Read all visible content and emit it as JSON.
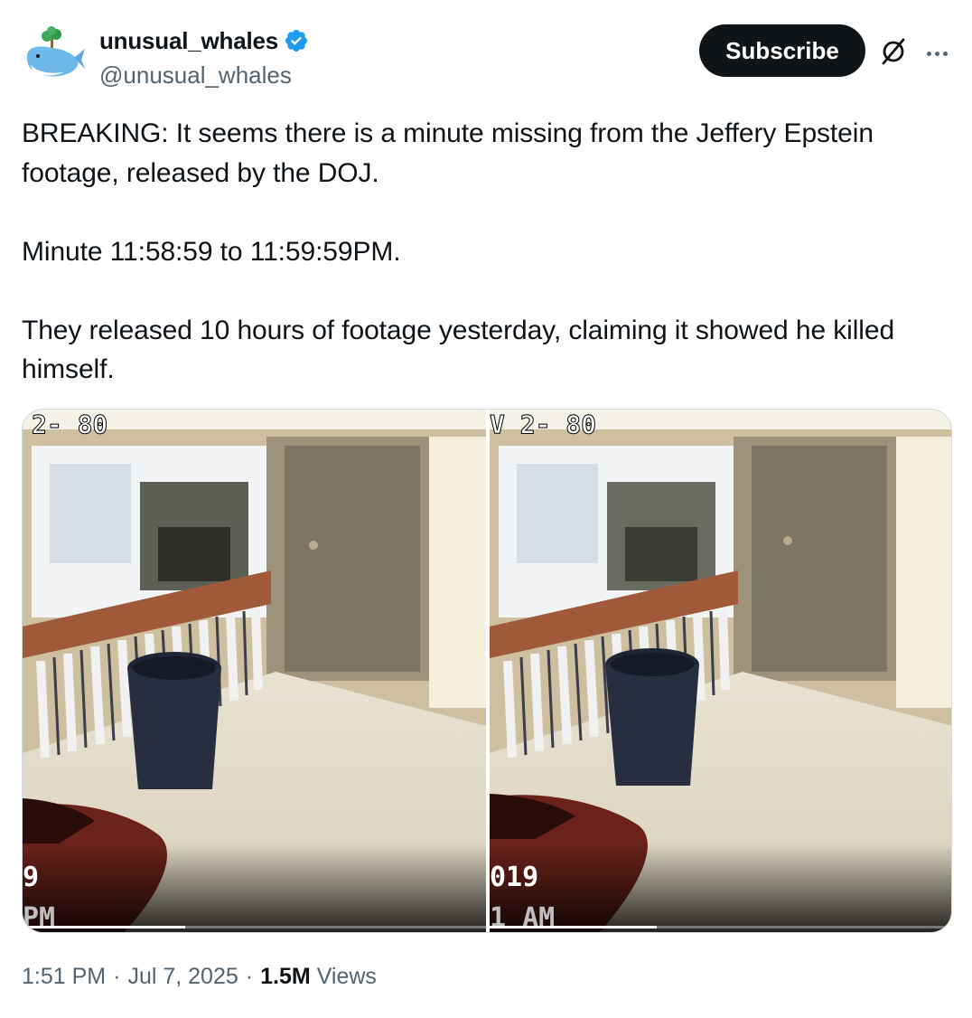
{
  "author": {
    "display_name": "unusual_whales",
    "handle": "@unusual_whales",
    "verified": true,
    "avatar_icon": "whale-logo-icon",
    "verified_color": "#1d9bf0"
  },
  "actions": {
    "subscribe_label": "Subscribe",
    "grok_icon": "grok-slash-icon",
    "more_icon": "more-horizontal-icon"
  },
  "tweet": {
    "paragraphs": [
      "BREAKING: It seems there is a minute missing from the Jeffery Epstein footage, released by the DOJ.",
      "Minute 11:58:59 to 11:59:59PM.",
      "They released 10 hours of footage yesterday, claiming it showed he killed himself."
    ]
  },
  "media": {
    "left": {
      "overlay_top": "2- 80",
      "overlay_date": "9",
      "overlay_time": "PM",
      "progress": 0.35
    },
    "right": {
      "overlay_top": "V 2- 80",
      "overlay_date": "019",
      "overlay_time": "1 AM",
      "progress": 0.36
    }
  },
  "meta": {
    "time": "1:51 PM",
    "date": "Jul 7, 2025",
    "separator": "·",
    "views_count": "1.5M",
    "views_label": "Views"
  },
  "colors": {
    "text_primary": "#0f1419",
    "text_secondary": "#536471",
    "button_dark": "#0f1419"
  }
}
